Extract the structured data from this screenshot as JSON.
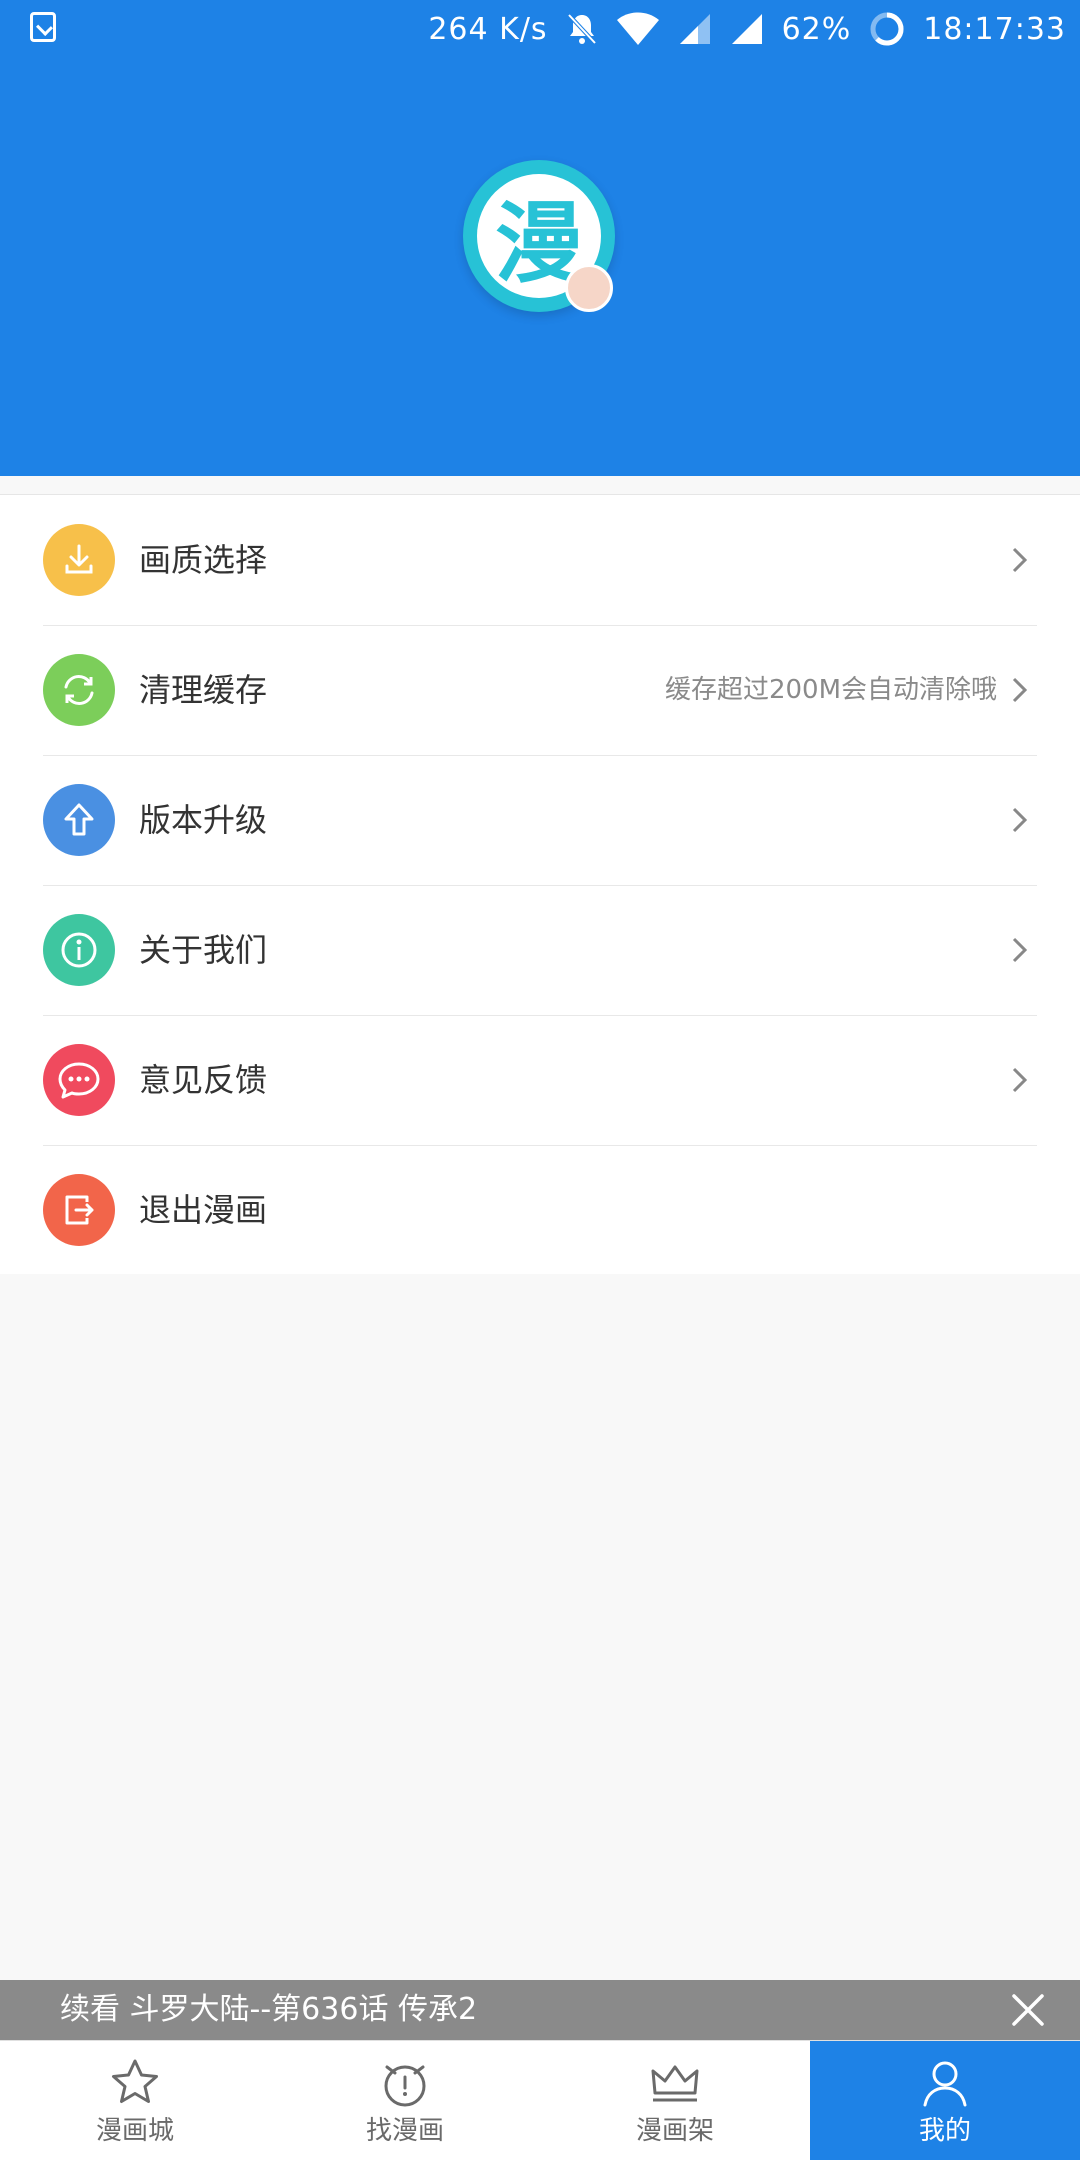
{
  "status_bar": {
    "speed": "264 K/s",
    "battery": "62%",
    "time": "18:17:33"
  },
  "header": {
    "logo_char": "漫"
  },
  "menu": [
    {
      "label": "画质选择",
      "hint": "",
      "color": "#f7c04a",
      "icon": "download-icon"
    },
    {
      "label": "清理缓存",
      "hint": "缓存超过200M会自动清除哦",
      "color": "#7cce5a",
      "icon": "refresh-icon"
    },
    {
      "label": "版本升级",
      "hint": "",
      "color": "#4a90e2",
      "icon": "upload-arrow-icon"
    },
    {
      "label": "关于我们",
      "hint": "",
      "color": "#3ec6a0",
      "icon": "info-icon"
    },
    {
      "label": "意见反馈",
      "hint": "",
      "color": "#f04a5e",
      "icon": "chat-bubble-icon"
    },
    {
      "label": "退出漫画",
      "hint": "",
      "color": "#f2654a",
      "icon": "logout-icon"
    }
  ],
  "continue_reading": {
    "text": "续看 斗罗大陆--第636话 传承2"
  },
  "bottom_nav": [
    {
      "label": "漫画城",
      "icon": "star-icon",
      "active": false
    },
    {
      "label": "找漫画",
      "icon": "compass-icon",
      "active": false
    },
    {
      "label": "漫画架",
      "icon": "crown-icon",
      "active": false
    },
    {
      "label": "我的",
      "icon": "person-icon",
      "active": true
    }
  ],
  "colors": {
    "primary": "#1e82e6",
    "background": "#f8f8f8"
  }
}
